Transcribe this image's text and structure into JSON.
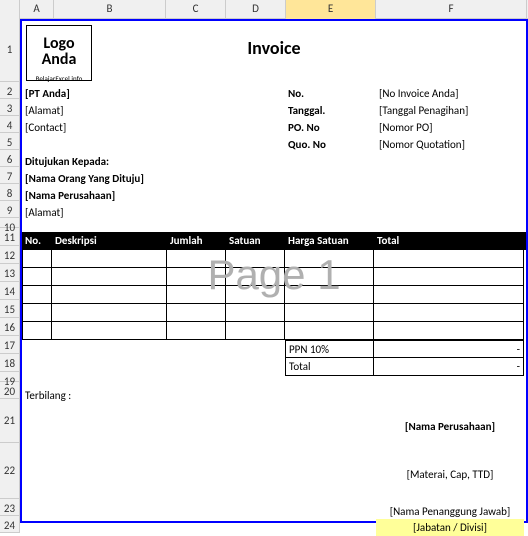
{
  "columns": [
    "A",
    "B",
    "C",
    "D",
    "E",
    "F"
  ],
  "rows": [
    1,
    2,
    3,
    4,
    5,
    6,
    7,
    8,
    9,
    10,
    11,
    12,
    13,
    14,
    15,
    16,
    17,
    18,
    19,
    20,
    21,
    22,
    23,
    24
  ],
  "logo": {
    "line1": "Logo",
    "line2": "Anda",
    "sub": "BelajarExcel.info"
  },
  "title": "Invoice",
  "sender": {
    "company": "[PT Anda]",
    "address": "[Alamat]",
    "contact": "[Contact]"
  },
  "meta": {
    "no_lab": "No.",
    "no_val": "[No Invoice Anda]",
    "tgl_lab": "Tanggal.",
    "tgl_val": "[Tanggal Penagihan]",
    "po_lab": "PO. No",
    "po_val": "[Nomor PO]",
    "quo_lab": "Quo. No",
    "quo_val": "[Nomor Quotation]"
  },
  "recipient": {
    "heading": "Ditujukan Kepada:",
    "name": "[Nama Orang Yang Dituju]",
    "company": "[Nama Perusahaan]",
    "address": "[Alamat]"
  },
  "tbl": {
    "no": "No.",
    "desk": "Deskripsi",
    "jml": "Jumlah",
    "sat": "Satuan",
    "hs": "Harga Satuan",
    "tot": "Total"
  },
  "summary": {
    "ppn": "PPN 10%",
    "total": "Total",
    "dash": "-"
  },
  "terbilang": "Terbilang :",
  "sign": {
    "company": "[Nama Perusahaan]",
    "stamp": "[Materai, Cap, TTD]",
    "pic": "[Nama Penanggung Jawab]",
    "role": "[Jabatan / Divisi]"
  },
  "watermark": "Page 1"
}
